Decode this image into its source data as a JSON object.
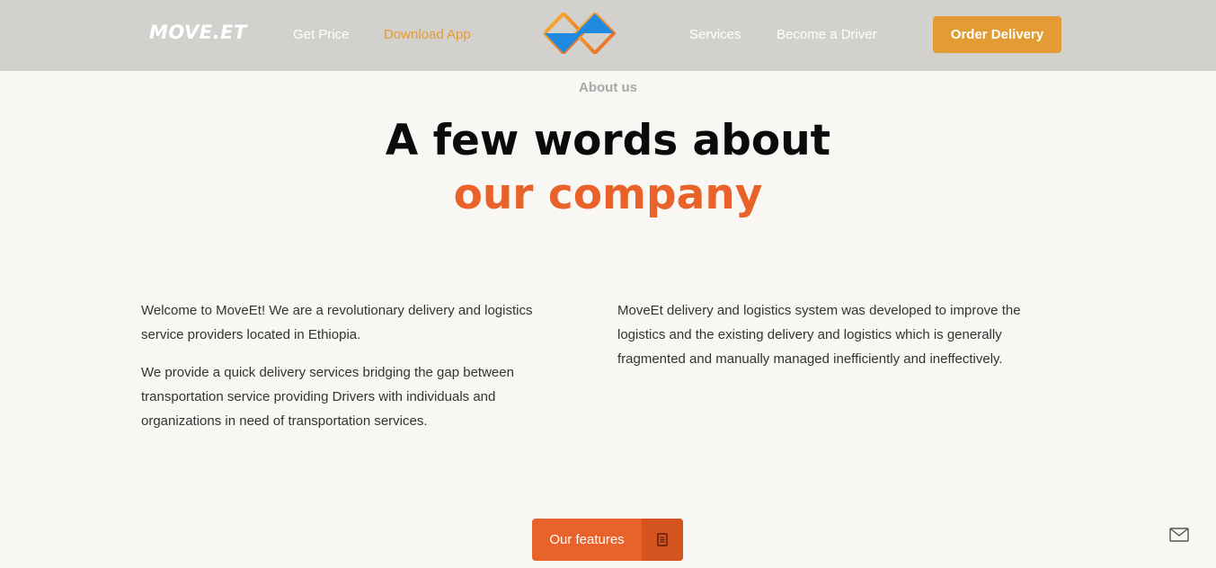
{
  "header": {
    "brand": "MOVE.ET",
    "nav_left": [
      "Get Price",
      "Download App"
    ],
    "nav_right": [
      "Services",
      "Become a Driver"
    ],
    "active_nav": "Download App",
    "order_button": "Order Delivery",
    "logo_icon": "moveet-diamond-logo"
  },
  "about": {
    "eyebrow": "About us",
    "title_line1": "A few words about",
    "title_line2": "our company",
    "left_paragraphs": [
      "Welcome to MoveEt! We are a revolutionary delivery and logistics service providers located in Ethiopia.",
      "We provide a quick delivery services bridging the gap between transportation service providing Drivers with individuals and organizations in need of transportation services."
    ],
    "right_paragraphs": [
      "MoveEt delivery and logistics system was developed to improve the logistics and the existing delivery and logistics which is generally fragmented and manually managed inefficiently and ineffectively."
    ],
    "features_button": "Our features",
    "features_icon": "document-icon"
  },
  "floating": {
    "mail_icon": "envelope-icon"
  },
  "colors": {
    "header_bg": "#d2d1ce",
    "page_bg": "#f8f7f3",
    "accent_orange": "#e9622a",
    "amber": "#e39b33",
    "logo_blue": "#1f8be0"
  }
}
